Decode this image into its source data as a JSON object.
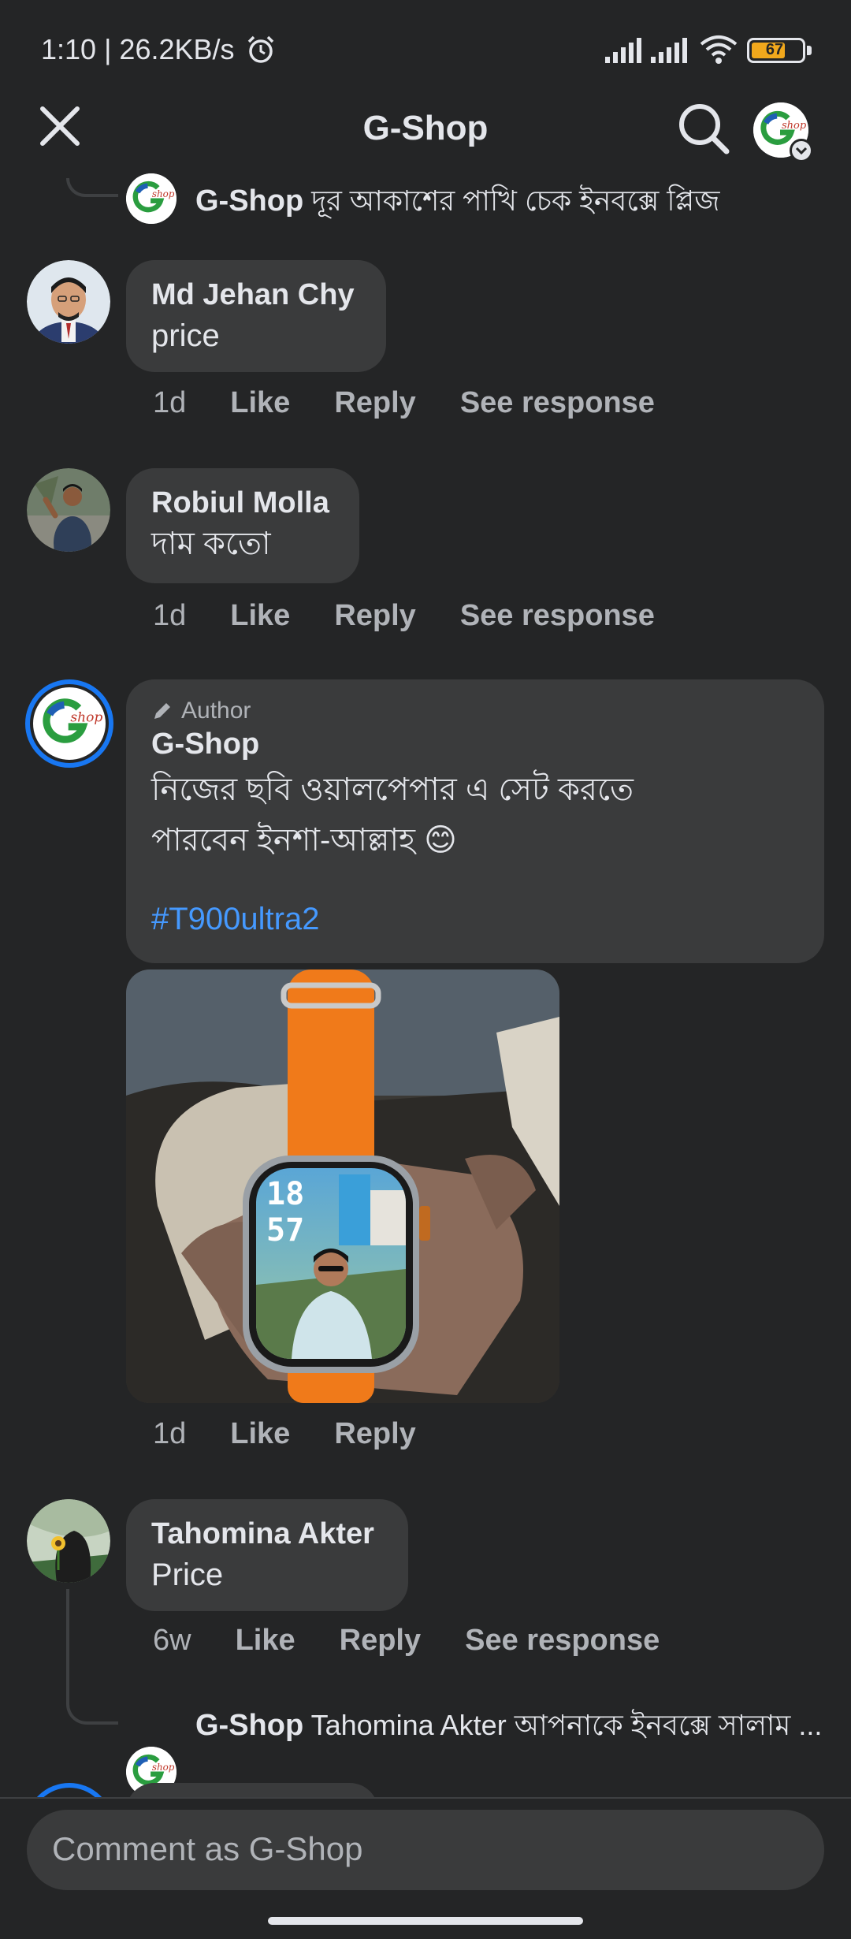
{
  "status": {
    "time_speed": "1:10 | 26.2KB/s",
    "battery": "67",
    "battery_level_percent": 67
  },
  "header": {
    "title": "G-Shop"
  },
  "thread": {
    "top_reply": {
      "author": "G-Shop",
      "text": "দূর আকাশের পাখি চেক ইনবক্সে প্লিজ"
    },
    "comments": [
      {
        "author": "Md Jehan Chy",
        "text": "price",
        "time": "1d",
        "like": "Like",
        "reply": "Reply",
        "see_response": "See response"
      },
      {
        "author": "Robiul Molla",
        "text": "দাম কতো",
        "time": "1d",
        "like": "Like",
        "reply": "Reply",
        "see_response": "See response"
      },
      {
        "badge": "Author",
        "author": "G-Shop",
        "text_line1": "নিজের ছবি ওয়ালপেপার এ সেট করতে",
        "text_line2": "পারবেন ইনশা-আল্লাহ 😊",
        "hashtag": "#T900ultra2",
        "watch_time_top": "18",
        "watch_time_bottom": "57",
        "time": "1d",
        "like": "Like",
        "reply": "Reply"
      },
      {
        "author": "Tahomina Akter",
        "text": "Price",
        "time": "6w",
        "like": "Like",
        "reply": "Reply",
        "see_response": "See response",
        "reply_preview_author": "G-Shop",
        "reply_preview_text": "Tahomina Akter আপনাকে ইনবক্সে সালাম ..."
      }
    ]
  },
  "composer": {
    "placeholder": "Comment as G-Shop"
  },
  "icons": {
    "close": "close-icon",
    "search": "search-icon",
    "alarm": "alarm-icon",
    "wifi": "wifi-icon",
    "edit": "pencil-icon"
  },
  "colors": {
    "background": "#242526",
    "bubble": "#3a3b3c",
    "hashtag": "#4599ff",
    "author_ring": "#1877f2",
    "watch_band": "#f07a1a"
  }
}
